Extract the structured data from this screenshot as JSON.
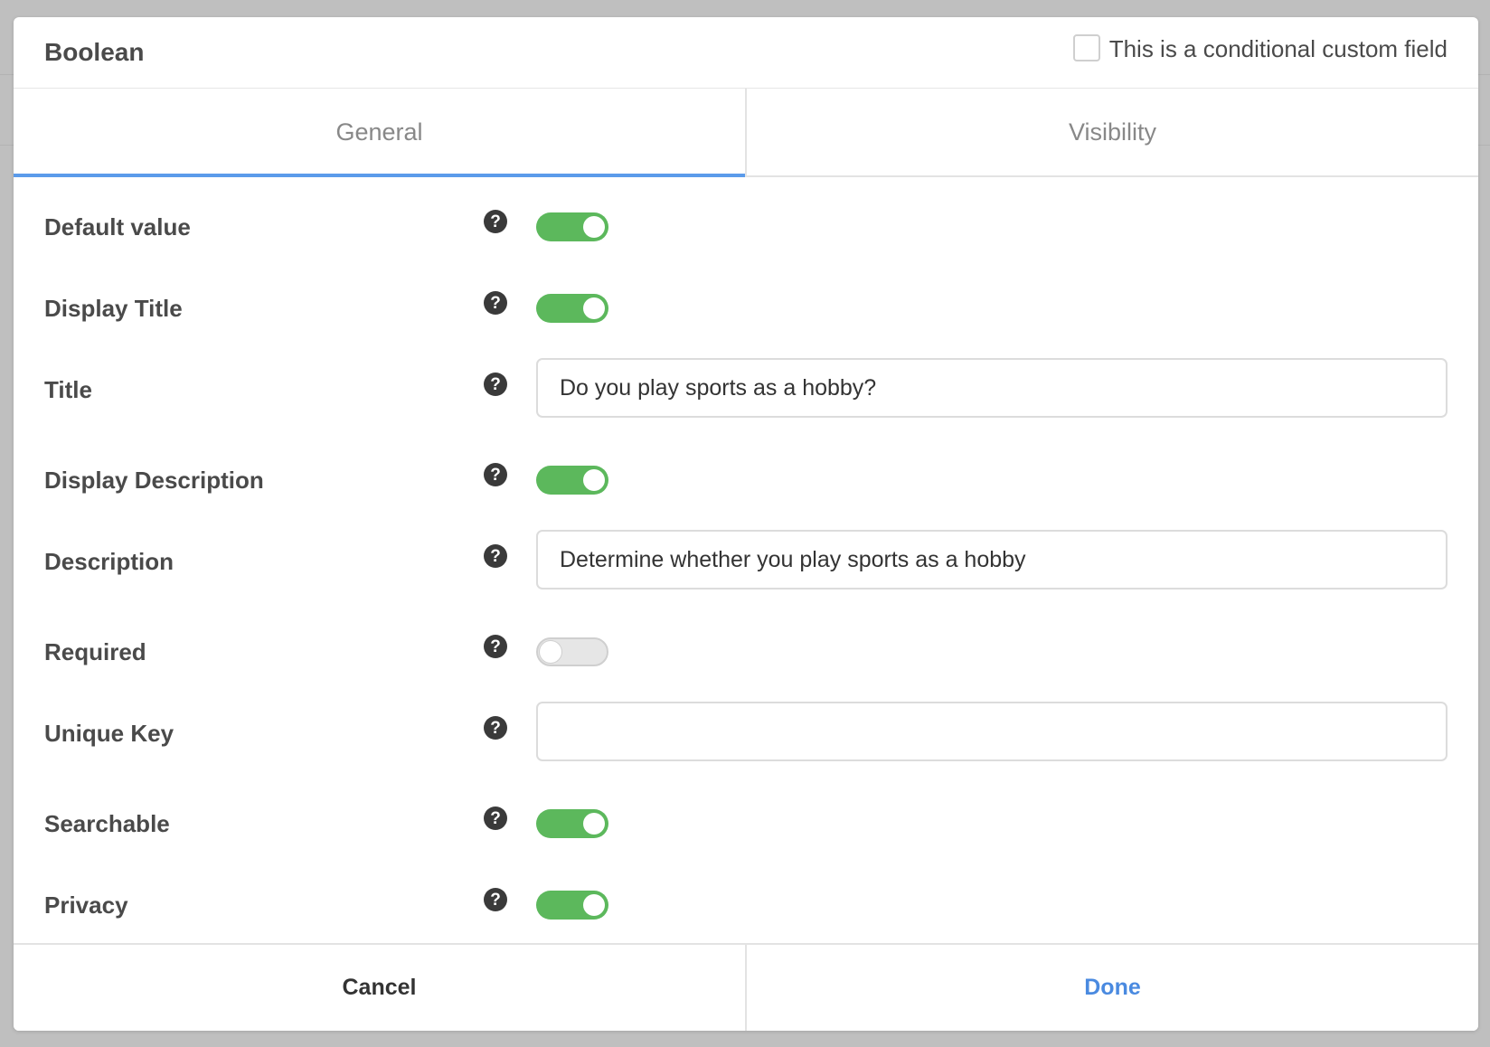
{
  "modal": {
    "title": "Boolean",
    "conditional_label": "This is a conditional custom field",
    "conditional_checked": false
  },
  "tabs": [
    {
      "label": "General",
      "active": true
    },
    {
      "label": "Visibility",
      "active": false
    }
  ],
  "fields": {
    "default_value": {
      "label": "Default value",
      "on": true
    },
    "display_title": {
      "label": "Display Title",
      "on": true
    },
    "title": {
      "label": "Title",
      "value": "Do you play sports as a hobby?"
    },
    "display_description": {
      "label": "Display Description",
      "on": true
    },
    "description": {
      "label": "Description",
      "value": "Determine whether you play sports as a hobby"
    },
    "required": {
      "label": "Required",
      "on": false
    },
    "unique_key": {
      "label": "Unique Key",
      "value": ""
    },
    "searchable": {
      "label": "Searchable",
      "on": true
    },
    "privacy": {
      "label": "Privacy",
      "on": true
    }
  },
  "help_icon_glyph": "?",
  "footer": {
    "cancel_label": "Cancel",
    "done_label": "Done"
  },
  "colors": {
    "toggle_on": "#5cb85c",
    "tab_active_underline": "#5b9bea",
    "done_text": "#4a8ae0"
  }
}
